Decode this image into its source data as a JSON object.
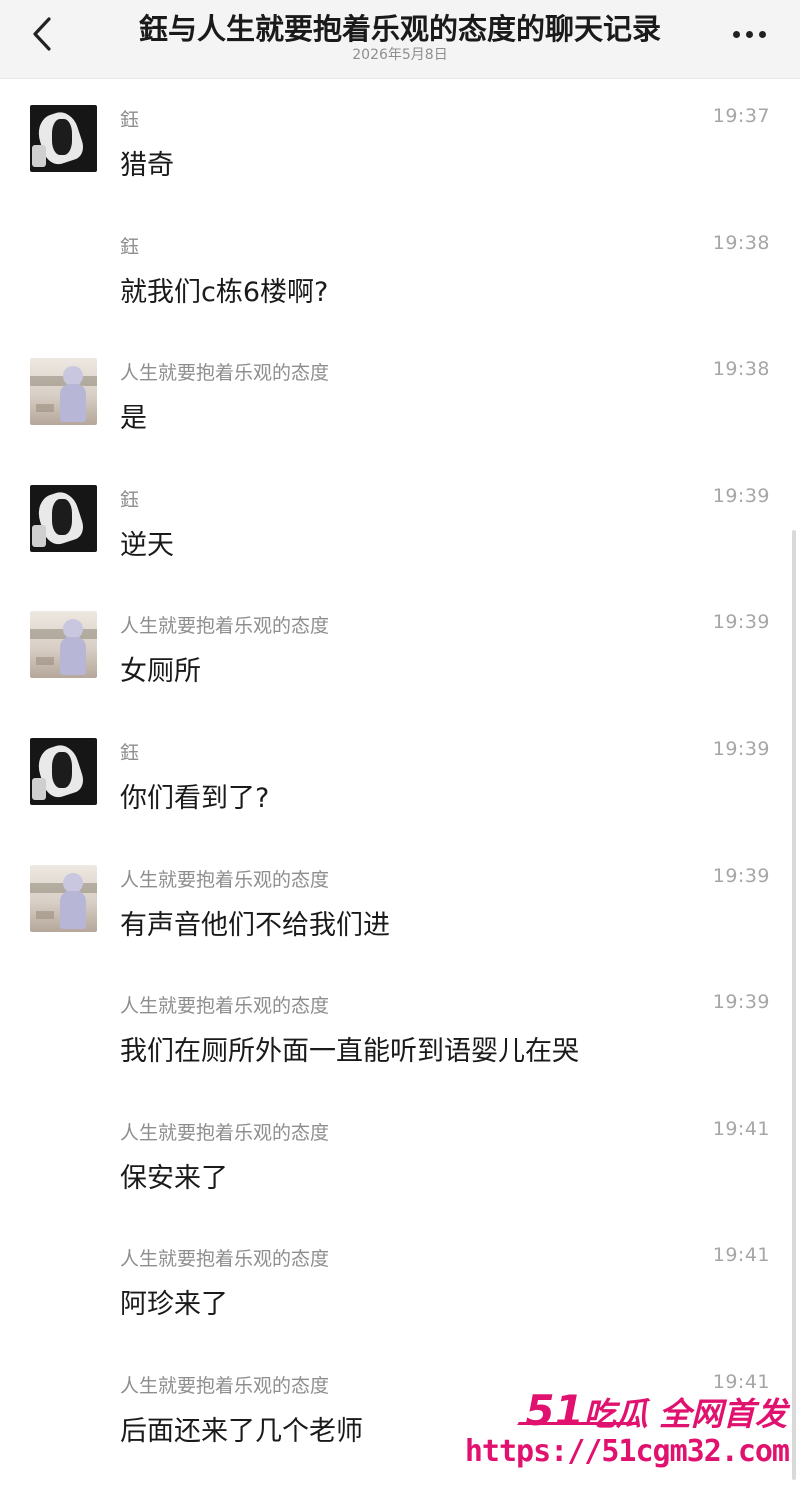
{
  "header": {
    "title": "鈺与人生就要抱着乐观的态度的聊天记录",
    "date": "2026年5月8日"
  },
  "messages": [
    {
      "sender": "鈺",
      "time": "19:37",
      "text": "猎奇",
      "avatar": "dark"
    },
    {
      "sender": "鈺",
      "time": "19:38",
      "text": "就我们c栋6楼啊?",
      "avatar": ""
    },
    {
      "sender": "人生就要抱着乐观的态度",
      "time": "19:38",
      "text": "是",
      "avatar": "light"
    },
    {
      "sender": "鈺",
      "time": "19:39",
      "text": "逆天",
      "avatar": "dark"
    },
    {
      "sender": "人生就要抱着乐观的态度",
      "time": "19:39",
      "text": "女厕所",
      "avatar": "light"
    },
    {
      "sender": "鈺",
      "time": "19:39",
      "text": "你们看到了?",
      "avatar": "dark"
    },
    {
      "sender": "人生就要抱着乐观的态度",
      "time": "19:39",
      "text": "有声音他们不给我们进",
      "avatar": "light"
    },
    {
      "sender": "人生就要抱着乐观的态度",
      "time": "19:39",
      "text": "我们在厕所外面一直能听到语婴儿在哭",
      "avatar": ""
    },
    {
      "sender": "人生就要抱着乐观的态度",
      "time": "19:41",
      "text": "保安来了",
      "avatar": ""
    },
    {
      "sender": "人生就要抱着乐观的态度",
      "time": "19:41",
      "text": "阿珍来了",
      "avatar": ""
    },
    {
      "sender": "人生就要抱着乐观的态度",
      "time": "19:41",
      "text": "后面还来了几个老师",
      "avatar": ""
    }
  ],
  "watermark": {
    "brand_number": "51",
    "brand_text": "吃瓜 全网首发",
    "url": "https://51cgm32.com"
  },
  "colors": {
    "header_bg": "#f4f4f4",
    "meta_text": "#8e8e8e",
    "watermark": "#e1126f"
  }
}
